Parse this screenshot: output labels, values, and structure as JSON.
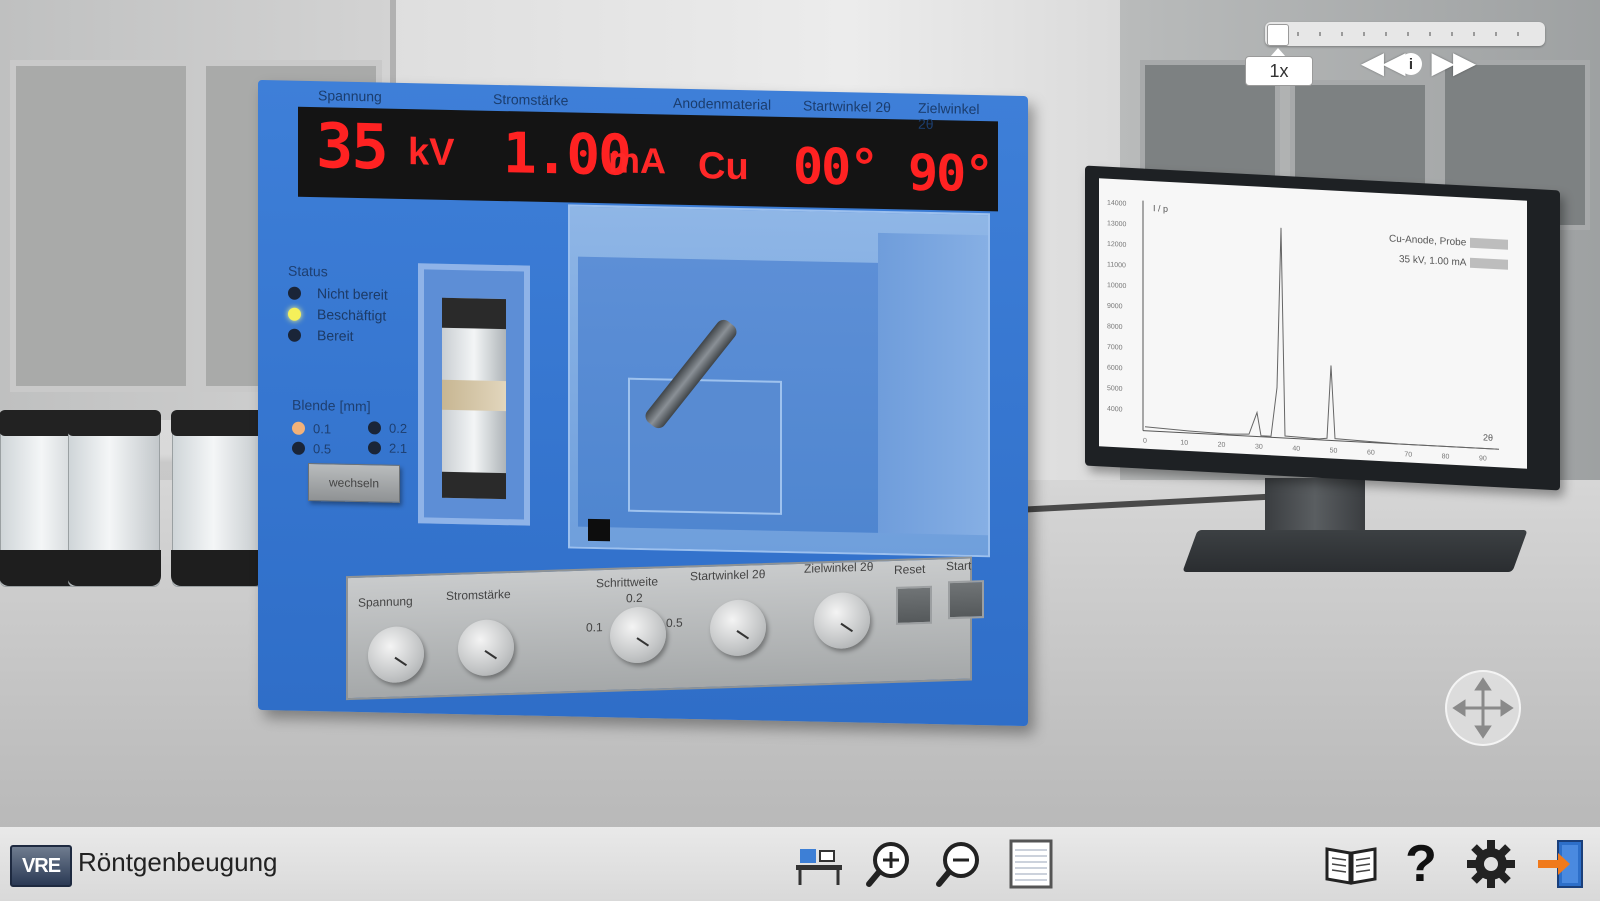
{
  "app": {
    "title": "Röntgenbeugung",
    "logo_text": "VRE"
  },
  "timeline": {
    "speed": "1x",
    "progress": 0.0
  },
  "device": {
    "display": {
      "labels": [
        "Spannung",
        "Stromstärke",
        "Anodenmaterial",
        "Startwinkel 2θ",
        "Zielwinkel 2θ"
      ],
      "voltage_value": "35",
      "voltage_unit": "kV",
      "current_value": "1.00",
      "current_unit": "mA",
      "anode": "Cu",
      "start_angle": "00°",
      "target_angle": "90°"
    },
    "status": {
      "title": "Status",
      "items": [
        {
          "label": "Nicht bereit",
          "state": "off"
        },
        {
          "label": "Beschäftigt",
          "state": "on"
        },
        {
          "label": "Bereit",
          "state": "off"
        }
      ]
    },
    "blende": {
      "title": "Blende [mm]",
      "options": [
        {
          "label": "0.1",
          "selected": true
        },
        {
          "label": "0.2",
          "selected": false
        },
        {
          "label": "0.5",
          "selected": false
        },
        {
          "label": "2.1",
          "selected": false
        }
      ],
      "button": "wechseln"
    },
    "panel": {
      "labels": [
        "Spannung",
        "Stromstärke",
        "Schrittweite",
        "Startwinkel 2θ",
        "Zielwinkel 2θ",
        "Reset",
        "Start"
      ],
      "step_values": [
        "0.1",
        "0.2",
        "0.5"
      ]
    }
  },
  "monitor": {
    "y_label": "I / p",
    "x_label": "2θ",
    "legend": [
      {
        "label": "Cu-Anode, Probe"
      },
      {
        "label": "35 kV, 1.00 mA"
      }
    ],
    "y_ticks": [
      "14000",
      "13000",
      "12000",
      "11000",
      "10000",
      "9000",
      "8000",
      "7000",
      "6000",
      "5000",
      "4000"
    ],
    "x_ticks": [
      "0",
      "10",
      "20",
      "30",
      "40",
      "50",
      "60",
      "70",
      "80",
      "90"
    ]
  },
  "toolbar": {
    "buttons": [
      "experiment-setup",
      "zoom-in",
      "zoom-out",
      "notes"
    ],
    "right_buttons": [
      "manual",
      "help",
      "settings",
      "exit"
    ],
    "help_label": "?"
  }
}
